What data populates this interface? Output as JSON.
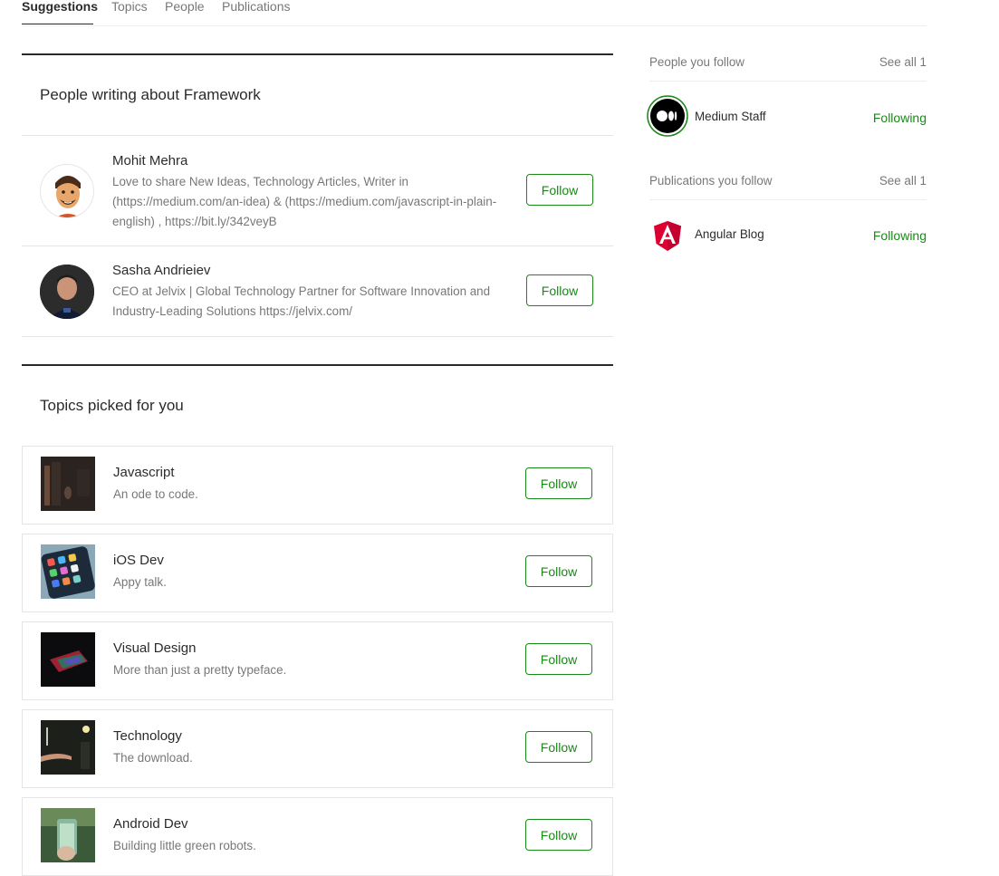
{
  "tabs": [
    "Suggestions",
    "Topics",
    "People",
    "Publications"
  ],
  "people_section": {
    "title": "People writing about Framework",
    "people": [
      {
        "name": "Mohit Mehra",
        "bio": "Love to share New Ideas, Technology Articles, Writer in (https://medium.com/an-idea) & (https://medium.com/javascript-in-plain-english) , https://bit.ly/342veyB",
        "button": "Follow"
      },
      {
        "name": "Sasha Andrieiev",
        "bio": "CEO at Jelvix | Global Technology Partner for Software Innovation and Industry-Leading Solutions https://jelvix.com/",
        "button": "Follow"
      }
    ]
  },
  "topics_section": {
    "title": "Topics picked for you",
    "topics": [
      {
        "name": "Javascript",
        "desc": "An ode to code.",
        "button": "Follow"
      },
      {
        "name": "iOS Dev",
        "desc": "Appy talk.",
        "button": "Follow"
      },
      {
        "name": "Visual Design",
        "desc": "More than just a pretty typeface.",
        "button": "Follow"
      },
      {
        "name": "Technology",
        "desc": "The download.",
        "button": "Follow"
      },
      {
        "name": "Android Dev",
        "desc": "Building little green robots.",
        "button": "Follow"
      }
    ]
  },
  "sidebar": {
    "people_follow": {
      "title": "People you follow",
      "see_all": "See all 1",
      "items": [
        {
          "name": "Medium Staff",
          "status": "Following"
        }
      ]
    },
    "pubs_follow": {
      "title": "Publications you follow",
      "see_all": "See all 1",
      "items": [
        {
          "name": "Angular Blog",
          "status": "Following"
        }
      ]
    }
  },
  "colors": {
    "accent": "#1a8917",
    "text": "#292929",
    "muted": "#757575"
  }
}
